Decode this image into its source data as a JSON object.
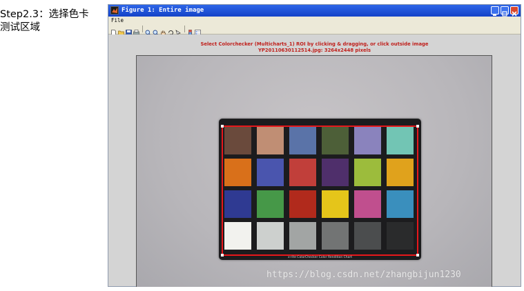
{
  "caption": {
    "line1": "Step2.3：选择色卡",
    "line2": "测试区域"
  },
  "window": {
    "title": "Figure 1: Entire image",
    "menu_file": "File"
  },
  "toolbar": {
    "icons": [
      "new-figure-icon",
      "open-file-icon",
      "save-icon",
      "print-icon",
      "zoom-in-icon",
      "zoom-out-icon",
      "pan-icon",
      "rotate-3d-icon",
      "data-cursor-icon",
      "colorbar-icon",
      "legend-icon"
    ]
  },
  "plot": {
    "title_line1": "Select Colorchecker (Multicharts_1) ROI by clicking & dragging, or click outside image",
    "title_line2": "YP20110630112514.jpg: 3264x2448 pixels"
  },
  "chart": {
    "caption": "x-rite  ColorChecker  Color Rendition Chart",
    "roi_color": "#e8171b",
    "patches": [
      [
        "#6a4a3c",
        "#c08e74",
        "#5a73a8",
        "#4d5f38",
        "#8a83bd",
        "#72c5b4"
      ],
      [
        "#d9701a",
        "#4a55ae",
        "#c13f3a",
        "#4f2f6b",
        "#9cbc3c",
        "#e0a21c"
      ],
      [
        "#2f3a92",
        "#469848",
        "#b12a1c",
        "#e5c51a",
        "#c04f8e",
        "#3a8fbd"
      ],
      [
        "#f2f2ee",
        "#cdd0ce",
        "#a2a5a4",
        "#727474",
        "#4b4d4e",
        "#2a2b2c"
      ]
    ]
  },
  "watermark": "https://blog.csdn.net/zhangbijun1230"
}
